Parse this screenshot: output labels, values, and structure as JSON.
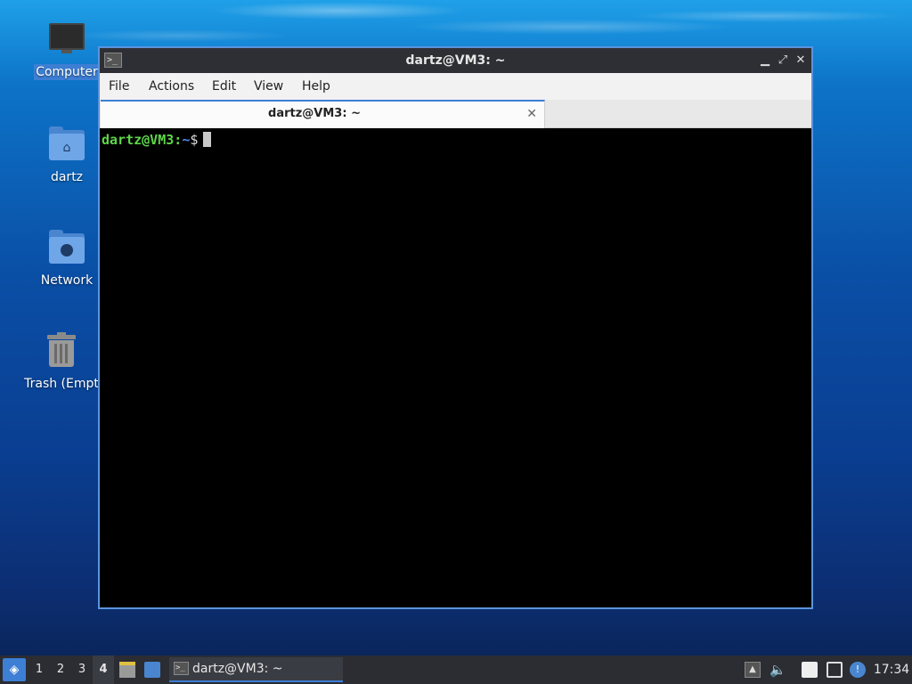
{
  "desktop": {
    "icons": [
      {
        "label": "Computer",
        "icon": "computer-icon"
      },
      {
        "label": "dartz",
        "icon": "home-folder-icon"
      },
      {
        "label": "Network",
        "icon": "network-folder-icon"
      },
      {
        "label": "Trash (Empt",
        "icon": "trash-icon"
      }
    ]
  },
  "window": {
    "title": "dartz@VM3: ~",
    "icon": "terminal-icon",
    "controls": {
      "minimize": "▁",
      "maximize": "⤢",
      "close": "✕"
    },
    "menu": [
      "File",
      "Actions",
      "Edit",
      "View",
      "Help"
    ],
    "tab": {
      "label": "dartz@VM3: ~",
      "close": "✕"
    },
    "prompt": {
      "user_host": "dartz@VM3",
      "sep": ":",
      "path": "~",
      "symbol": "$"
    }
  },
  "taskbar": {
    "start_icon": "start-menu-icon",
    "workspaces": [
      "1",
      "2",
      "3",
      "4"
    ],
    "active_workspace": "4",
    "task": {
      "label": "dartz@VM3: ~",
      "icon": "terminal-icon"
    },
    "tray_icons": [
      "up-arrow-icon",
      "volume-icon",
      "clipboard-icon",
      "network-icon",
      "update-icon"
    ],
    "clock": "17:34"
  },
  "colors": {
    "accent": "#3d7fd4",
    "prompt_user": "#5ed64b",
    "prompt_path": "#4f8ae8",
    "terminal_bg": "#000000",
    "titlebar_bg": "#2e2f35",
    "taskbar_bg": "#2b2d33"
  }
}
